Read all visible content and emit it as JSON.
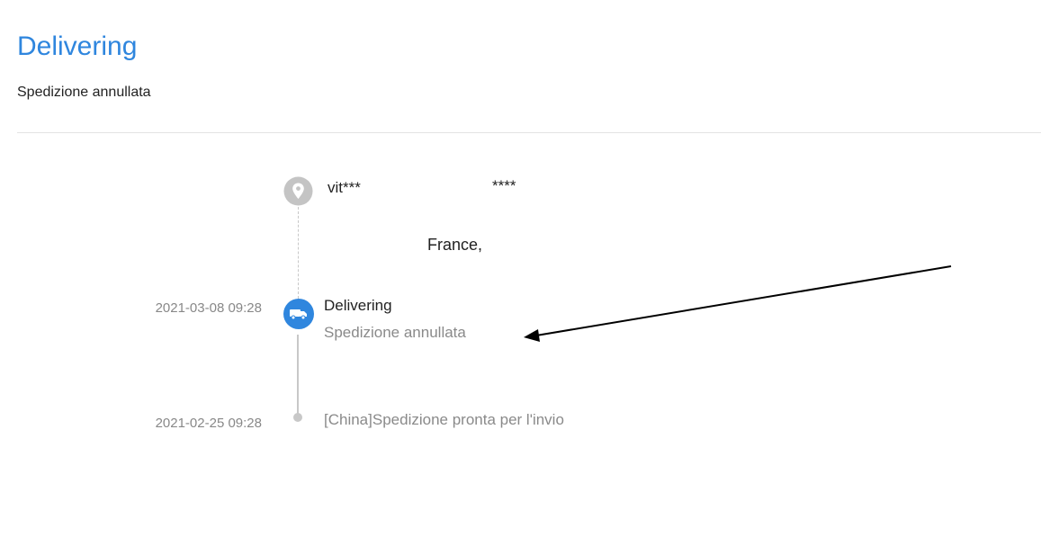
{
  "header": {
    "title": "Delivering",
    "subtitle": "Spedizione annullata"
  },
  "address": {
    "name": "vit***",
    "masked": "****",
    "country": "France,"
  },
  "events": [
    {
      "time": "2021-03-08 09:28",
      "title": "Delivering",
      "description": "Spedizione annullata",
      "icon": "truck-icon"
    },
    {
      "time": "2021-02-25 09:28",
      "description": "[China]Spedizione pronta per l'invio",
      "icon": "dot-icon"
    }
  ],
  "colors": {
    "accent": "#2f86de",
    "muted": "#8a8a8a",
    "line": "#c8c8c8"
  }
}
